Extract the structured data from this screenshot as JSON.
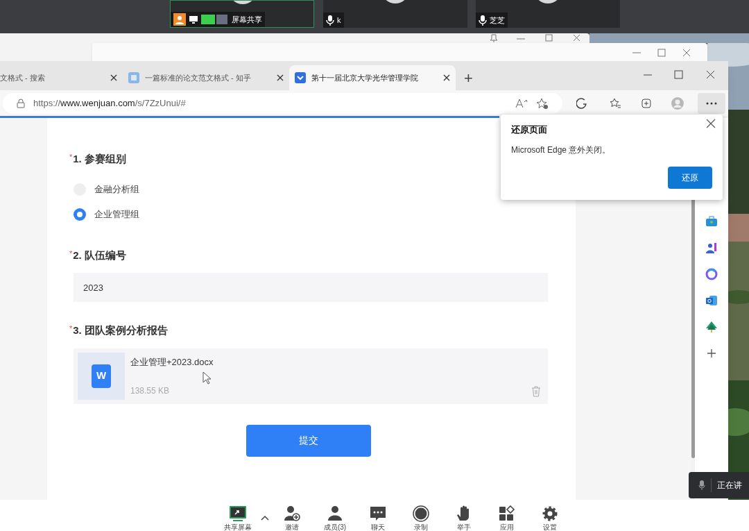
{
  "meeting": {
    "tiles": [
      {
        "label": "屏幕共享",
        "kind": "sharing",
        "selected": true
      },
      {
        "label": "k",
        "kind": "mic",
        "selected": false
      },
      {
        "label": "芝芝",
        "kind": "mic",
        "selected": false
      }
    ],
    "speaking_indicator": "正在讲"
  },
  "browser": {
    "tabs": [
      {
        "title": "文格式 - 搜索",
        "selected": false
      },
      {
        "title": "一篇标准的论文范文格式 - 知乎",
        "selected": false
      },
      {
        "title": "第十一届北京大学光华管理学院",
        "selected": true
      }
    ],
    "new_tab": "+",
    "url": "https://**www.wenjuan.com**/s/7ZzUnui/#"
  },
  "form": {
    "questions": [
      {
        "title": "1. 参赛组别",
        "required_mark": "*",
        "kind": "radio",
        "options": [
          {
            "label": "金融分析组",
            "selected": false
          },
          {
            "label": "企业管理组",
            "selected": true
          }
        ]
      },
      {
        "title": "2. 队伍编号",
        "required_mark": "*",
        "kind": "text",
        "value": "2023"
      },
      {
        "title": "3. 团队案例分析报告",
        "required_mark": "*",
        "kind": "upload",
        "file_name": "企业管理+2023.docx",
        "file_size": "138.55 KB",
        "file_icon": "W"
      }
    ],
    "submit": "提交"
  },
  "popup": {
    "title": "还原页面",
    "message": "Microsoft Edge 意外关闭。",
    "button": "还原"
  },
  "toolbar": [
    {
      "label": "共享屏幕"
    },
    {
      "label": "邀请"
    },
    {
      "label": "成员(3)"
    },
    {
      "label": "聊天"
    },
    {
      "label": "录制"
    },
    {
      "label": "举手"
    },
    {
      "label": "应用"
    },
    {
      "label": "设置"
    }
  ]
}
